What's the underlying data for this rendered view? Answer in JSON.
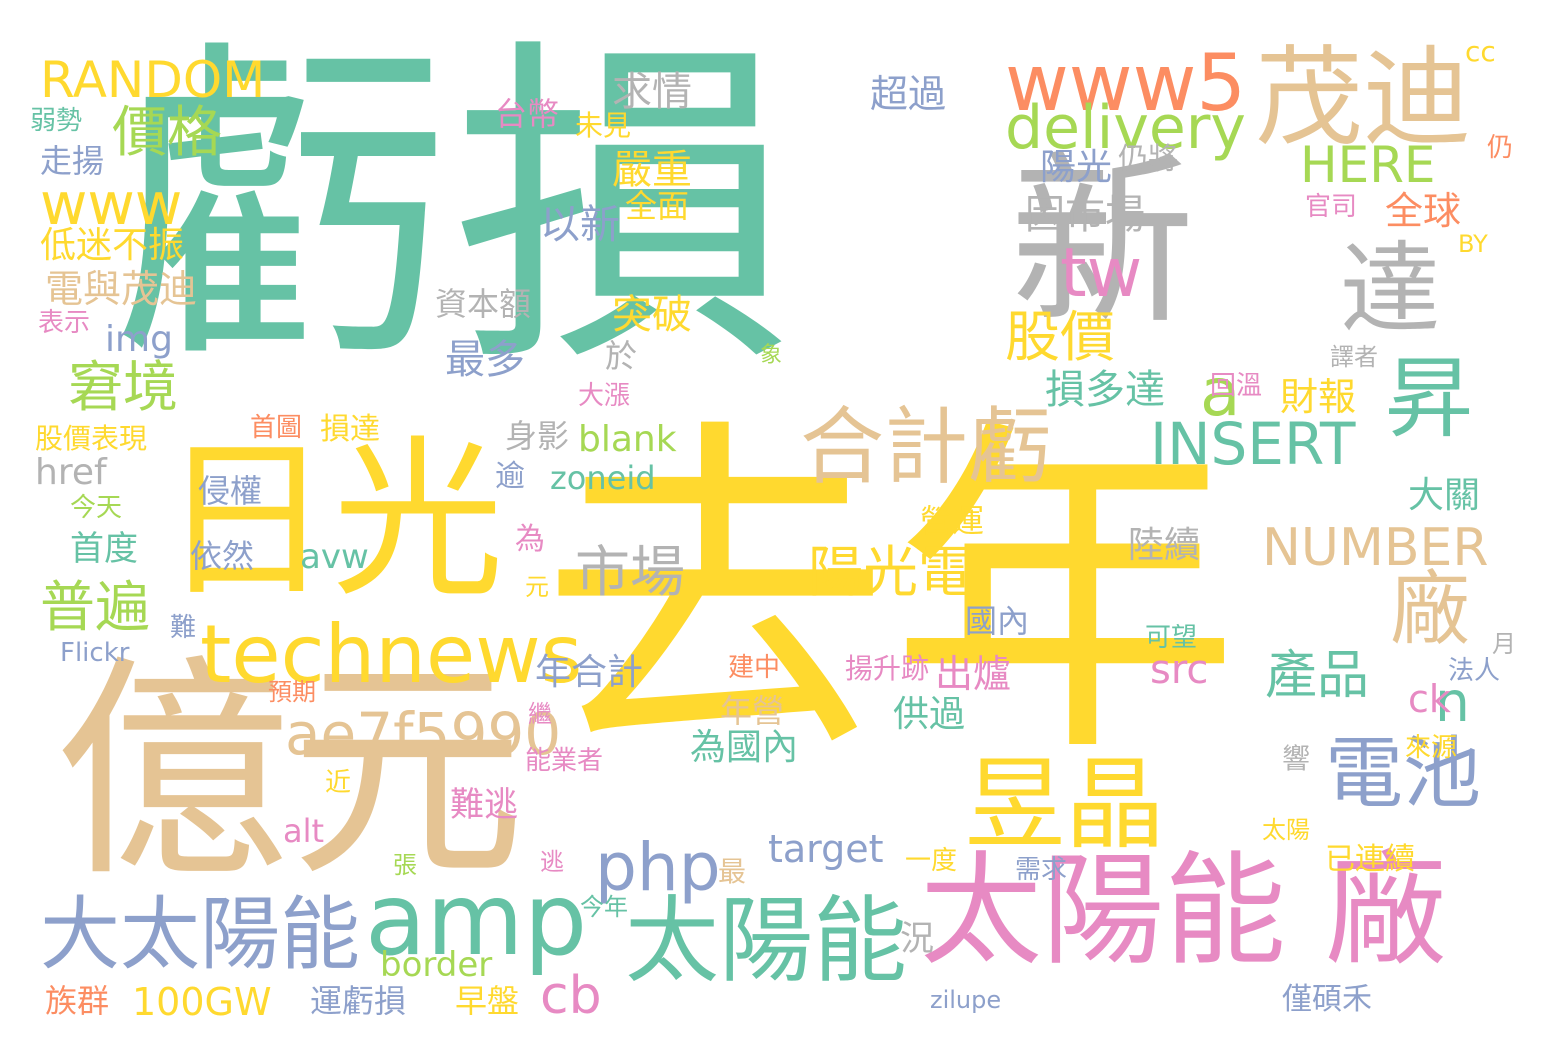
{
  "palette": {
    "teal": "#66c2a5",
    "yellow": "#ffd92f",
    "tan": "#e5c494",
    "gray": "#b3b3b3",
    "pink": "#e78ac3",
    "blue": "#8da0cb",
    "green": "#a6d854",
    "orange": "#fc8d62"
  },
  "words": [
    {
      "text": "虧損",
      "color": "#66c2a5"
    },
    {
      "text": "去年",
      "color": "#ffd92f"
    },
    {
      "text": "億元",
      "color": "#e5c494"
    },
    {
      "text": "日光",
      "color": "#ffd92f"
    },
    {
      "text": "新",
      "color": "#b3b3b3"
    },
    {
      "text": "太陽能 廠",
      "color": "#e78ac3"
    },
    {
      "text": "茂迪",
      "color": "#e5c494"
    },
    {
      "text": "www5",
      "color": "#fc8d62"
    },
    {
      "text": "達",
      "color": "#b3b3b3"
    },
    {
      "text": "amp",
      "color": "#66c2a5"
    },
    {
      "text": "太陽能",
      "color": "#66c2a5"
    },
    {
      "text": "大太陽能",
      "color": "#8da0cb"
    },
    {
      "text": "昱晶",
      "color": "#ffd92f"
    },
    {
      "text": "technews",
      "color": "#ffd92f"
    },
    {
      "text": "合計虧",
      "color": "#e5c494"
    },
    {
      "text": "昇",
      "color": "#66c2a5"
    },
    {
      "text": "廠",
      "color": "#e5c494"
    },
    {
      "text": "電池",
      "color": "#8da0cb"
    },
    {
      "text": "delivery",
      "color": "#a6d854"
    },
    {
      "text": "ae7f5990",
      "color": "#e5c494"
    },
    {
      "text": "RANDOM",
      "color": "#ffd92f"
    },
    {
      "text": "www",
      "color": "#ffd92f"
    },
    {
      "text": "價格",
      "color": "#a6d854"
    },
    {
      "text": "窘境",
      "color": "#a6d854"
    },
    {
      "text": "普遍",
      "color": "#a6d854"
    },
    {
      "text": "市場",
      "color": "#b3b3b3"
    },
    {
      "text": "陽光電",
      "color": "#ffd92f"
    },
    {
      "text": "股價",
      "color": "#ffd92f"
    },
    {
      "text": "tw",
      "color": "#e78ac3"
    },
    {
      "text": "a",
      "color": "#a6d854"
    },
    {
      "text": "php",
      "color": "#8da0cb"
    },
    {
      "text": "INSERT",
      "color": "#66c2a5"
    },
    {
      "text": "NUMBER",
      "color": "#e5c494"
    },
    {
      "text": "HERE",
      "color": "#a6d854"
    },
    {
      "text": "產品",
      "color": "#66c2a5"
    },
    {
      "text": "cb",
      "color": "#e78ac3"
    },
    {
      "text": "n",
      "color": "#66c2a5"
    },
    {
      "text": "求情",
      "color": "#b3b3b3"
    },
    {
      "text": "超過",
      "color": "#8da0cb"
    },
    {
      "text": "台幣",
      "color": "#e78ac3"
    },
    {
      "text": "未見",
      "color": "#ffd92f"
    },
    {
      "text": "嚴重",
      "color": "#ffd92f"
    },
    {
      "text": "全面",
      "color": "#ffd92f"
    },
    {
      "text": "以新",
      "color": "#8da0cb"
    },
    {
      "text": "陽光",
      "color": "#8da0cb"
    },
    {
      "text": "仍將",
      "color": "#b3b3b3"
    },
    {
      "text": "因市場",
      "color": "#b3b3b3"
    },
    {
      "text": "全球",
      "color": "#fc8d62"
    },
    {
      "text": "官司",
      "color": "#e78ac3"
    },
    {
      "text": "BY",
      "color": "#ffd92f"
    },
    {
      "text": "cc",
      "color": "#ffd92f"
    },
    {
      "text": "仍",
      "color": "#fc8d62"
    },
    {
      "text": "弱勢",
      "color": "#66c2a5"
    },
    {
      "text": "走揚",
      "color": "#8da0cb"
    },
    {
      "text": "低迷不振",
      "color": "#ffd92f"
    },
    {
      "text": "電與茂迪",
      "color": "#e5c494"
    },
    {
      "text": "表示",
      "color": "#e78ac3"
    },
    {
      "text": "img",
      "color": "#8da0cb"
    },
    {
      "text": "資本額",
      "color": "#b3b3b3"
    },
    {
      "text": "突破",
      "color": "#ffd92f"
    },
    {
      "text": "最多",
      "color": "#8da0cb"
    },
    {
      "text": "於",
      "color": "#b3b3b3"
    },
    {
      "text": "損多達",
      "color": "#66c2a5"
    },
    {
      "text": "財報",
      "color": "#ffd92f"
    },
    {
      "text": "回溫",
      "color": "#e78ac3"
    },
    {
      "text": "譯者",
      "color": "#b3b3b3"
    },
    {
      "text": "象",
      "color": "#a6d854"
    },
    {
      "text": "大漲",
      "color": "#e78ac3"
    },
    {
      "text": "首圖",
      "color": "#fc8d62"
    },
    {
      "text": "損達",
      "color": "#ffd92f"
    },
    {
      "text": "股價表現",
      "color": "#ffd92f"
    },
    {
      "text": "身影",
      "color": "#b3b3b3"
    },
    {
      "text": "blank",
      "color": "#a6d854"
    },
    {
      "text": "zoneid",
      "color": "#66c2a5"
    },
    {
      "text": "逾",
      "color": "#8da0cb"
    },
    {
      "text": "href",
      "color": "#b3b3b3"
    },
    {
      "text": "侵權",
      "color": "#8da0cb"
    },
    {
      "text": "今天",
      "color": "#a6d854"
    },
    {
      "text": "首度",
      "color": "#66c2a5"
    },
    {
      "text": "依然",
      "color": "#8da0cb"
    },
    {
      "text": "avw",
      "color": "#66c2a5"
    },
    {
      "text": "營運",
      "color": "#ffd92f"
    },
    {
      "text": "陸續",
      "color": "#b3b3b3"
    },
    {
      "text": "大關",
      "color": "#66c2a5"
    },
    {
      "text": "為",
      "color": "#e78ac3"
    },
    {
      "text": "元",
      "color": "#ffd92f"
    },
    {
      "text": "國內",
      "color": "#8da0cb"
    },
    {
      "text": "可望",
      "color": "#66c2a5"
    },
    {
      "text": "月",
      "color": "#b3b3b3"
    },
    {
      "text": "難",
      "color": "#8da0cb"
    },
    {
      "text": "Flickr",
      "color": "#8da0cb"
    },
    {
      "text": "年合計",
      "color": "#8da0cb"
    },
    {
      "text": "出爐",
      "color": "#e78ac3"
    },
    {
      "text": "src",
      "color": "#e78ac3"
    },
    {
      "text": "建中",
      "color": "#fc8d62"
    },
    {
      "text": "揚升跡",
      "color": "#e78ac3"
    },
    {
      "text": "法人",
      "color": "#8da0cb"
    },
    {
      "text": "預期",
      "color": "#fc8d62"
    },
    {
      "text": "供過",
      "color": "#66c2a5"
    },
    {
      "text": "年營",
      "color": "#e5c494"
    },
    {
      "text": "ck",
      "color": "#e78ac3"
    },
    {
      "text": "繼",
      "color": "#e78ac3"
    },
    {
      "text": "能業者",
      "color": "#e78ac3"
    },
    {
      "text": "為國內",
      "color": "#66c2a5"
    },
    {
      "text": "來源",
      "color": "#ffd92f"
    },
    {
      "text": "近",
      "color": "#ffd92f"
    },
    {
      "text": "響",
      "color": "#b3b3b3"
    },
    {
      "text": "難逃",
      "color": "#e78ac3"
    },
    {
      "text": "alt",
      "color": "#e78ac3"
    },
    {
      "text": "target",
      "color": "#8da0cb"
    },
    {
      "text": "最",
      "color": "#e5c494"
    },
    {
      "text": "太陽",
      "color": "#ffd92f"
    },
    {
      "text": "已連續",
      "color": "#ffd92f"
    },
    {
      "text": "逃",
      "color": "#e78ac3"
    },
    {
      "text": "張",
      "color": "#a6d854"
    },
    {
      "text": "一度",
      "color": "#ffd92f"
    },
    {
      "text": "需求",
      "color": "#8da0cb"
    },
    {
      "text": "今年",
      "color": "#66c2a5"
    },
    {
      "text": "況",
      "color": "#b3b3b3"
    },
    {
      "text": "border",
      "color": "#a6d854"
    },
    {
      "text": "族群",
      "color": "#fc8d62"
    },
    {
      "text": "100GW",
      "color": "#ffd92f"
    },
    {
      "text": "運虧損",
      "color": "#8da0cb"
    },
    {
      "text": "早盤",
      "color": "#ffd92f"
    },
    {
      "text": "zilupe",
      "color": "#8da0cb"
    },
    {
      "text": "僅碩禾",
      "color": "#8da0cb"
    }
  ]
}
